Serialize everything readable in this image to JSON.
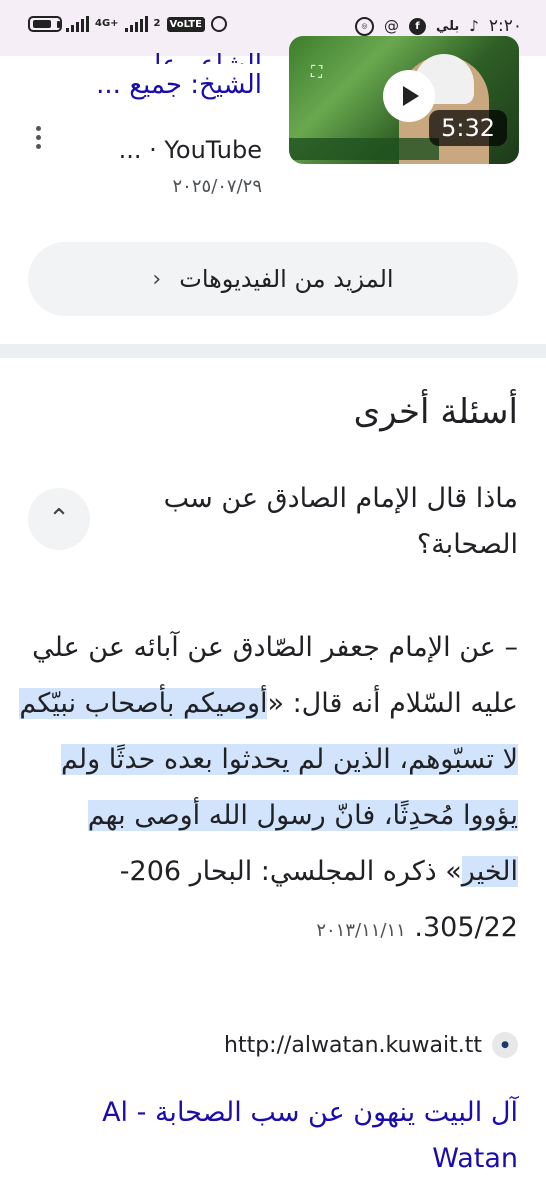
{
  "status_bar": {
    "time": "٢:٢٠",
    "network_label": "4G+",
    "sim_label": "2",
    "volte_label": "VoLTE",
    "carrier_app_label": "بلي",
    "icons": [
      "battery-icon",
      "signal-icon",
      "alarm-icon",
      "tiktok-icon",
      "facebook-icon",
      "threads-icon",
      "app-circle-icon"
    ]
  },
  "video": {
    "title_line1": "الشاعر علي",
    "title_line2": "الشيخ: جميع ...",
    "source": "YouTube · ...",
    "date": "٢٠٢٥/٠٧/٢٩",
    "duration": "5:32"
  },
  "more_videos_label": "المزيد من الفيديوهات",
  "people_also_ask": {
    "heading": "أسئلة أخرى",
    "question": "ماذا قال الإمام الصادق عن سب الصحابة؟",
    "answer_intro": "– عن الإمام جعفر الصّادق عن آبائه عن علي عليه السّلام أنه قال: «",
    "answer_highlight": "أوصيكم بأصحاب نبيّكم لا تسبّوهم، الذين لم يحدثوا بعده حدثًا ولم يؤووا مُحدِثًا، فانّ رسول الله أوصى بهم الخير",
    "answer_outro": "» ذكره المجلسي: البحار 206-305/22.",
    "answer_date": "٢٠١٣/١١/١١",
    "source_url": "http://alwatan.kuwait.tt",
    "result_title": "آل البيت ينهون عن سب الصحابة - Al Watan"
  }
}
